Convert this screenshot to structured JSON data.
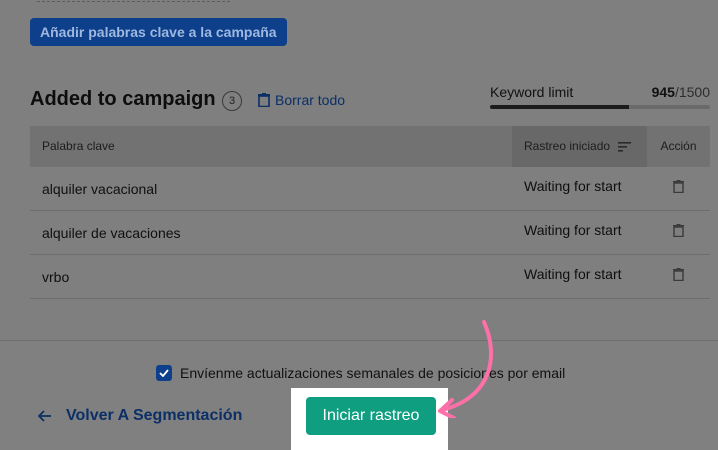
{
  "top": {
    "add_keywords_button": "Añadir palabras clave a la campaña"
  },
  "campaign": {
    "title": "Added to campaign",
    "count": "3",
    "clear_all": "Borrar todo",
    "keyword_limit_label": "Keyword limit",
    "keyword_limit_used": "945",
    "keyword_limit_total": "/1500",
    "keyword_limit_fraction": 0.63
  },
  "table": {
    "headers": {
      "keyword": "Palabra clave",
      "status": "Rastreo iniciado",
      "action": "Acción"
    },
    "rows": [
      {
        "keyword": "alquiler vacacional",
        "status": "Waiting for start"
      },
      {
        "keyword": "alquiler de vacaciones",
        "status": "Waiting for start"
      },
      {
        "keyword": "vrbo",
        "status": "Waiting for start"
      }
    ]
  },
  "footer": {
    "weekly_updates_label": "Envíenme actualizaciones semanales de posiciones por email",
    "weekly_updates_checked": true,
    "back_link": "Volver A Segmentación",
    "start_button": "Iniciar rastreo"
  },
  "colors": {
    "primary_blue": "#0d3f8a",
    "start_green": "#0f9f80",
    "arrow_pink": "#ff6fa8"
  }
}
